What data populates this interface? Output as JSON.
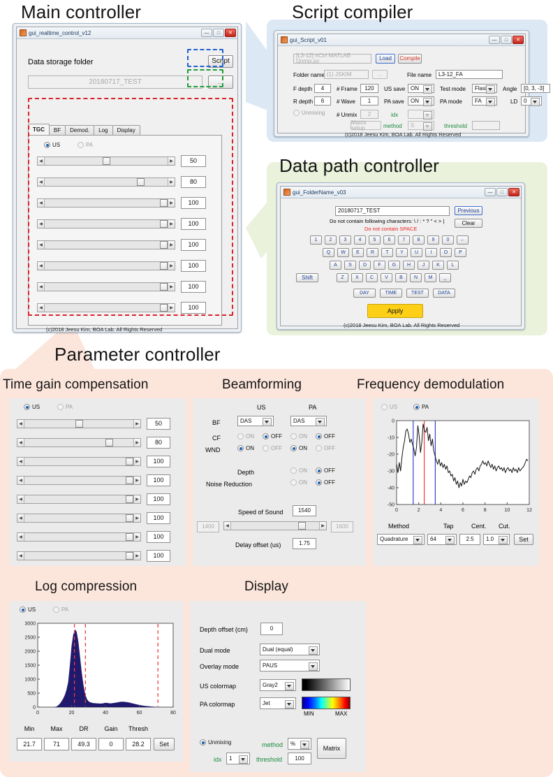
{
  "figure": {
    "sections": [
      {
        "id": "main-controller",
        "title": "Main controller"
      },
      {
        "id": "script-compiler",
        "title": "Script compiler"
      },
      {
        "id": "data-path-controller",
        "title": "Data path controller"
      },
      {
        "id": "parameter-controller",
        "title": "Parameter controller"
      }
    ],
    "colors": {
      "callout_blue": "#dce9f5",
      "callout_green": "#eaf2dc",
      "callout_pink": "#fce6dc",
      "dash_blue": "#1f5fd0",
      "dash_green": "#1e9e3a",
      "dash_red": "#d8232a",
      "accent_blue": "#1a5fb4",
      "red_text": "#ee2222",
      "green_text": "#1a8a3c",
      "histogram_fill": "#201a6e",
      "marker_red": "#ef3b3b",
      "marker_blue": "#3344cc"
    }
  },
  "main_controller": {
    "window_title": "gui_realtime_control_v12",
    "titlebar": {
      "minimize": "—",
      "maximize": "□",
      "close": "✕"
    },
    "storage_label": "Data storage folder",
    "storage_value": "20180717_TEST",
    "script_button": "Script",
    "browse_button": "...",
    "tabs": [
      {
        "label": "TGC",
        "active": true
      },
      {
        "label": "BF",
        "active": false
      },
      {
        "label": "Demod.",
        "active": false
      },
      {
        "label": "Log",
        "active": false
      },
      {
        "label": "Display",
        "active": false
      }
    ],
    "mode_us": "US",
    "mode_pa": "PA",
    "mode_selected": "US",
    "tgc_values": [
      "50",
      "80",
      "100",
      "100",
      "100",
      "100",
      "100",
      "100"
    ],
    "tgc_fractions": [
      0.5,
      0.8,
      1.0,
      1.0,
      1.0,
      1.0,
      1.0,
      1.0
    ],
    "copyright": "(c)2018 Jeesu Kim, BOA Lab. All Rights Reserved"
  },
  "script_compiler": {
    "window_title": "gui_Script_v01",
    "titlebar": {
      "minimize": "—",
      "maximize": "□",
      "close": "✕"
    },
    "script_path": "[L3-12] rtCtrl MATLAB Unmix.py",
    "load_button": "Load",
    "compile_button": "Compile",
    "folder_name_label": "Folder name",
    "folder_name_value": "(1) JSKIM",
    "folder_browse": "...",
    "file_name_label": "File name",
    "file_name_value": "L3-12_FA",
    "f_depth_label": "F depth",
    "f_depth_value": "4",
    "r_depth_label": "R depth",
    "r_depth_value": "6",
    "n_frame_label": "# Frame",
    "n_frame_value": "120",
    "n_wave_label": "# Wave",
    "n_wave_value": "1",
    "us_save_label": "US save",
    "us_save_value": "ON",
    "pa_save_label": "PA save",
    "pa_save_value": "ON",
    "test_mode_label": "Test mode",
    "test_mode_value": "Flash",
    "pa_mode_label": "PA mode",
    "pa_mode_value": "FA",
    "angle_label": "Angle",
    "angle_value": "[0, 3, -3]",
    "ld_label": "LD",
    "ld_value": "0",
    "unmixing_label": "Unmixing",
    "unmixing_on": false,
    "n_unmix_label": "# Unmix",
    "n_unmix_value": "2",
    "idx_label": "idx",
    "idx_value": "",
    "matrix_setup_button": "Matrix setup",
    "method_label": "method",
    "method_value": "S",
    "threshold_label": "threshold",
    "threshold_value": "",
    "copyright": "(c)2018 Jeesu Kim, BOA Lab. All Rights Reserved"
  },
  "data_path_controller": {
    "window_title": "gui_FolderName_v03",
    "titlebar": {
      "minimize": "—",
      "maximize": "□",
      "close": "✕"
    },
    "folder_value": "20180717_TEST",
    "previous_button": "Previous",
    "clear_button": "Clear",
    "warning_1": "Do not contain following characters: \\ / : * ? \" < > |",
    "warning_2": "Do not contain SPACE",
    "keyboard_rows": [
      [
        "1",
        "2",
        "3",
        "4",
        "5",
        "6",
        "7",
        "8",
        "9",
        "0",
        "←"
      ],
      [
        "Q",
        "W",
        "E",
        "R",
        "T",
        "Y",
        "U",
        "I",
        "O",
        "P"
      ],
      [
        "A",
        "S",
        "D",
        "F",
        "G",
        "H",
        "J",
        "K",
        "L"
      ],
      [
        "Z",
        "X",
        "C",
        "V",
        "B",
        "N",
        "M",
        "_"
      ]
    ],
    "shift_key": "Shift",
    "macro_keys": [
      "DAY",
      "TIME",
      "TEST",
      "DATA"
    ],
    "apply_button": "Apply",
    "copyright": "(c)2018 Jeesu Kim, BOA Lab. All Rights Reserved"
  },
  "parameter_controller": {
    "tgc": {
      "title": "Time gain compensation",
      "mode_us": "US",
      "mode_pa": "PA",
      "mode_selected": "US",
      "values": [
        "50",
        "80",
        "100",
        "100",
        "100",
        "100",
        "100",
        "100"
      ],
      "fractions": [
        0.5,
        0.8,
        1.0,
        1.0,
        1.0,
        1.0,
        1.0,
        1.0
      ]
    },
    "beamforming": {
      "title": "Beamforming",
      "col_us": "US",
      "col_pa": "PA",
      "bf_label": "BF",
      "bf_us": "DAS",
      "bf_pa": "DAS",
      "cf_label": "CF",
      "cf_us": "OFF",
      "cf_pa": "OFF",
      "wnd_label": "WND",
      "wnd_us": "ON",
      "wnd_pa": "ON",
      "on_label": "ON",
      "off_label": "OFF",
      "depth_label": "Depth",
      "depth_value": "OFF",
      "noise_label": "Noise Reduction",
      "noise_value": "OFF",
      "sos_label": "Speed of Sound",
      "sos_value": "1540",
      "sos_min": "1400",
      "sos_max": "1600",
      "sos_fraction": 0.7,
      "delay_label": "Delay offset (us)",
      "delay_value": "1.75"
    },
    "demod": {
      "title": "Frequency demodulation",
      "mode_us": "US",
      "mode_pa": "PA",
      "mode_selected": "PA",
      "method_label": "Method",
      "method_value": "Quadrature",
      "tap_label": "Tap",
      "tap_value": "64",
      "cent_label": "Cent.",
      "cent_value": "2.5",
      "cut_label": "Cut.",
      "cut_value": "1.0",
      "set_button": "Set"
    },
    "log": {
      "title": "Log compression",
      "mode_us": "US",
      "mode_pa": "PA",
      "mode_selected": "US",
      "fields": [
        {
          "label": "Min",
          "value": "21.7"
        },
        {
          "label": "Max",
          "value": "71"
        },
        {
          "label": "DR",
          "value": "49.3"
        },
        {
          "label": "Gain",
          "value": "0"
        },
        {
          "label": "Thresh",
          "value": "28.2"
        }
      ],
      "set_button": "Set"
    },
    "display": {
      "title": "Display",
      "depth_offset_label": "Depth offset (cm)",
      "depth_offset_value": "0",
      "dual_mode_label": "Dual mode",
      "dual_mode_value": "Dual (equal)",
      "overlay_mode_label": "Overlay mode",
      "overlay_mode_value": "PAUS",
      "us_colormap_label": "US colormap",
      "us_colormap_value": "Gray2",
      "pa_colormap_label": "PA colormap",
      "pa_colormap_value": "Jet",
      "cbar_min": "MIN",
      "cbar_max": "MAX",
      "unmixing_label": "Unmixing",
      "unmixing_on": true,
      "method_label": "method",
      "method_value": "%",
      "idx_label": "idx",
      "idx_value": "1",
      "threshold_label": "threshold",
      "threshold_value": "100",
      "matrix_button": "Matrix"
    }
  },
  "chart_data": [
    {
      "id": "demod-spectrum",
      "type": "line",
      "title": "",
      "xlabel": "",
      "ylabel": "",
      "xlim": [
        0,
        12
      ],
      "ylim": [
        -50,
        0
      ],
      "xticks": [
        0,
        2,
        4,
        6,
        8,
        10,
        12
      ],
      "yticks": [
        0,
        -10,
        -20,
        -30,
        -40,
        -50
      ],
      "grid": false,
      "annotations": [
        {
          "type": "vline",
          "x": 1.5,
          "color": "#3344cc",
          "label": "low cutoff"
        },
        {
          "type": "vline",
          "x": 2.5,
          "color": "#ef3b3b",
          "label": "center frequency"
        },
        {
          "type": "vline",
          "x": 3.5,
          "color": "#3344cc",
          "label": "high cutoff"
        }
      ],
      "x": [
        0,
        0.12,
        0.24,
        0.36,
        0.48,
        0.6,
        0.72,
        0.84,
        0.96,
        1.08,
        1.2,
        1.32,
        1.44,
        1.56,
        1.68,
        1.8,
        1.92,
        2.04,
        2.16,
        2.28,
        2.4,
        2.52,
        2.64,
        2.76,
        2.88,
        3,
        3.12,
        3.24,
        3.36,
        3.48,
        3.6,
        3.72,
        3.84,
        3.96,
        4.08,
        4.2,
        4.32,
        4.44,
        4.56,
        4.68,
        4.8,
        4.92,
        5.04,
        5.16,
        5.28,
        5.4,
        5.52,
        5.64,
        5.76,
        5.88,
        6,
        6.12,
        6.24,
        6.36,
        6.48,
        6.6,
        6.72,
        6.84,
        6.96,
        7.08,
        7.2,
        7.32,
        7.44,
        7.56,
        7.68,
        7.8,
        7.92,
        8.04,
        8.16,
        8.28,
        8.4,
        8.52,
        8.64,
        8.76,
        8.88,
        9,
        9.12,
        9.24,
        9.36,
        9.48,
        9.6,
        9.72,
        9.84,
        9.96,
        10.08,
        10.2,
        10.32,
        10.44,
        10.56,
        10.68,
        10.8,
        10.92,
        11.04,
        11.16,
        11.28,
        11.4,
        11.52,
        11.64,
        11.76,
        11.88,
        12
      ],
      "y": [
        -26,
        -31,
        -25,
        -30,
        -22,
        -16,
        -12,
        -6,
        -5,
        -8,
        -13,
        -11,
        -14,
        -17,
        -21,
        -16,
        -3,
        -9,
        -19,
        -13,
        -2,
        -6,
        -7,
        -4,
        -12,
        -8,
        -15,
        -11,
        -18,
        -21,
        -24,
        -26,
        -23,
        -27,
        -25,
        -28,
        -26,
        -29,
        -27,
        -31,
        -30,
        -33,
        -32,
        -36,
        -34,
        -38,
        -36,
        -40,
        -37,
        -39,
        -35,
        -38,
        -36,
        -37,
        -35,
        -33,
        -34,
        -31,
        -30,
        -32,
        -29,
        -28,
        -30,
        -27,
        -26,
        -24,
        -26,
        -25,
        -27,
        -24,
        -26,
        -28,
        -26,
        -29,
        -27,
        -30,
        -28,
        -27,
        -29,
        -28,
        -30,
        -28,
        -31,
        -29,
        -28,
        -30,
        -29,
        -31,
        -28,
        -30,
        -29,
        -31,
        -28,
        -30,
        -29,
        -28,
        -27,
        -25,
        -23,
        -24
      ]
    },
    {
      "id": "log-histogram",
      "type": "bar",
      "title": "",
      "xlabel": "",
      "ylabel": "",
      "xlim": [
        0,
        80
      ],
      "ylim": [
        0,
        3000
      ],
      "xticks": [
        0,
        20,
        40,
        60,
        80
      ],
      "yticks": [
        0,
        500,
        1000,
        1500,
        2000,
        2500,
        3000
      ],
      "grid": false,
      "annotations": [
        {
          "type": "vline",
          "x": 21.7,
          "color": "#ef3b3b",
          "label": "Min"
        },
        {
          "type": "vline",
          "x": 28.2,
          "color": "#ef3b3b",
          "label": "Thresh"
        },
        {
          "type": "vline",
          "x": 71,
          "color": "#ef3b3b",
          "label": "Max"
        }
      ],
      "bin_centers": [
        0,
        1,
        2,
        3,
        4,
        5,
        6,
        7,
        8,
        9,
        10,
        11,
        12,
        13,
        14,
        15,
        16,
        17,
        18,
        19,
        20,
        21,
        22,
        23,
        24,
        25,
        26,
        27,
        28,
        29,
        30,
        31,
        32,
        33,
        34,
        35,
        36,
        37,
        38,
        39,
        40,
        41,
        42,
        43,
        44,
        45,
        46,
        47,
        48,
        49,
        50,
        51,
        52,
        53,
        54,
        55,
        56,
        57,
        58,
        59,
        60,
        61,
        62,
        63,
        64,
        65,
        66,
        67,
        68,
        69,
        70,
        71,
        72,
        73,
        74,
        75,
        76,
        77,
        78,
        79,
        80
      ],
      "counts": [
        0,
        0,
        0,
        0,
        0,
        0,
        0,
        0,
        0,
        0,
        5,
        20,
        60,
        120,
        200,
        300,
        430,
        620,
        900,
        1500,
        2200,
        2600,
        2780,
        2700,
        2350,
        1800,
        1250,
        800,
        480,
        300,
        210,
        175,
        155,
        145,
        140,
        135,
        130,
        128,
        130,
        140,
        155,
        150,
        140,
        135,
        140,
        150,
        160,
        170,
        180,
        190,
        195,
        190,
        185,
        175,
        165,
        150,
        135,
        120,
        105,
        90,
        78,
        66,
        56,
        48,
        40,
        33,
        27,
        22,
        18,
        14,
        10,
        7,
        4,
        2,
        1,
        0,
        0,
        0,
        0,
        0,
        0
      ]
    }
  ]
}
